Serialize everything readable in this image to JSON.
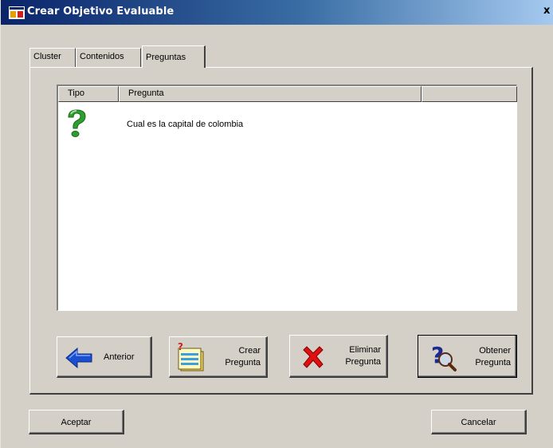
{
  "window": {
    "title": "Crear Objetivo Evaluable",
    "close_glyph": "x"
  },
  "tabs": [
    {
      "label": "Cluster",
      "active": false
    },
    {
      "label": "Contenidos",
      "active": false
    },
    {
      "label": "Preguntas",
      "active": true
    }
  ],
  "listview": {
    "columns": [
      "Tipo",
      "Pregunta",
      ""
    ],
    "rows": [
      {
        "tipo_icon": "question-mark-icon",
        "pregunta": "Cual es la capital de colombia"
      }
    ]
  },
  "actions": {
    "anterior": "Anterior",
    "crear": "Crear\nPregunta",
    "eliminar": "Eliminar\nPregunta",
    "obtener": "Obtener\nPregunta"
  },
  "footer": {
    "aceptar": "Aceptar",
    "cancelar": "Cancelar"
  },
  "colors": {
    "titlebar_start": "#0a246a",
    "titlebar_end": "#a6caf0",
    "dialog_face": "#d4d0c8",
    "question_icon": "#2e9e2e",
    "arrow_icon": "#1a4fd0",
    "delete_icon": "#e01010"
  }
}
